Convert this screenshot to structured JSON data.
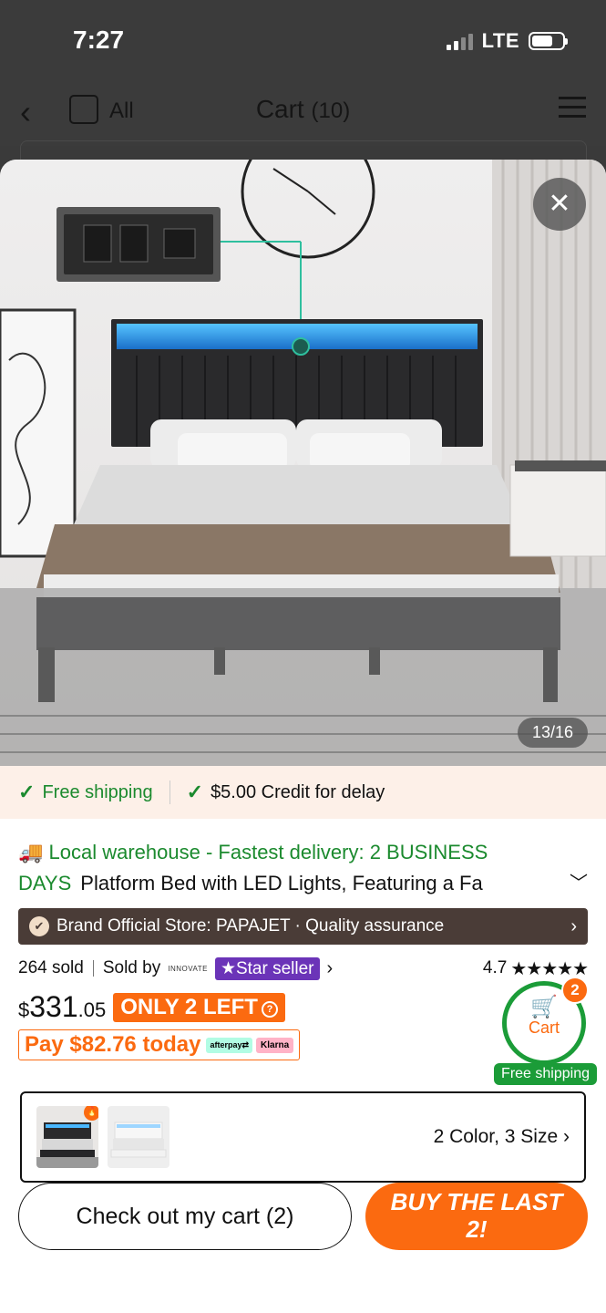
{
  "status_bar": {
    "time": "7:27",
    "network": "LTE"
  },
  "nav": {
    "select_all_label": "All",
    "title": "Cart",
    "title_count": "(10)"
  },
  "gallery": {
    "counter": "13/16"
  },
  "shipping_strip": {
    "free_shipping": "Free shipping",
    "credit": "$5.00 Credit for delay"
  },
  "product": {
    "delivery_line1": "Local warehouse - Fastest delivery: 2 BUSINESS",
    "delivery_line2": "DAYS",
    "name": "Platform Bed with LED Lights, Featuring a Fa",
    "brand_bar": "Brand Official Store: PAPAJET · Quality assurance",
    "sold": "264 sold",
    "sold_by": "Sold by",
    "seller_logo_text": "INNOVATE",
    "star_seller": "Star seller",
    "rating": "4.7",
    "stars": "★★★★★",
    "price_symbol": "$",
    "price_whole": "331",
    "price_cents": ".05",
    "stock_badge": "ONLY 2 LEFT",
    "pay_today": "Pay $82.76 today",
    "afterpay": "afterpay⇄",
    "klarna": "Klarna"
  },
  "cart_bubble": {
    "label": "Cart",
    "count": "2",
    "free_shipping": "Free shipping"
  },
  "variant": {
    "options": "2 Color, 3 Size"
  },
  "actions": {
    "checkout": "Check out my cart (2)",
    "buy_last_line1": "BUY THE LAST",
    "buy_last_line2": "2!"
  },
  "colors": {
    "accent": "#fb6a10",
    "green": "#1b8a2e",
    "brand_bar": "#4a3c37",
    "star_seller": "#6b34b8"
  },
  "icons": [
    "back-arrow-icon",
    "checkbox-icon",
    "menu-icon",
    "close-icon",
    "check-icon",
    "truck-icon",
    "verified-badge-icon",
    "chevron-right-icon",
    "chevron-down-icon",
    "star-icon",
    "info-icon",
    "cart-icon"
  ]
}
